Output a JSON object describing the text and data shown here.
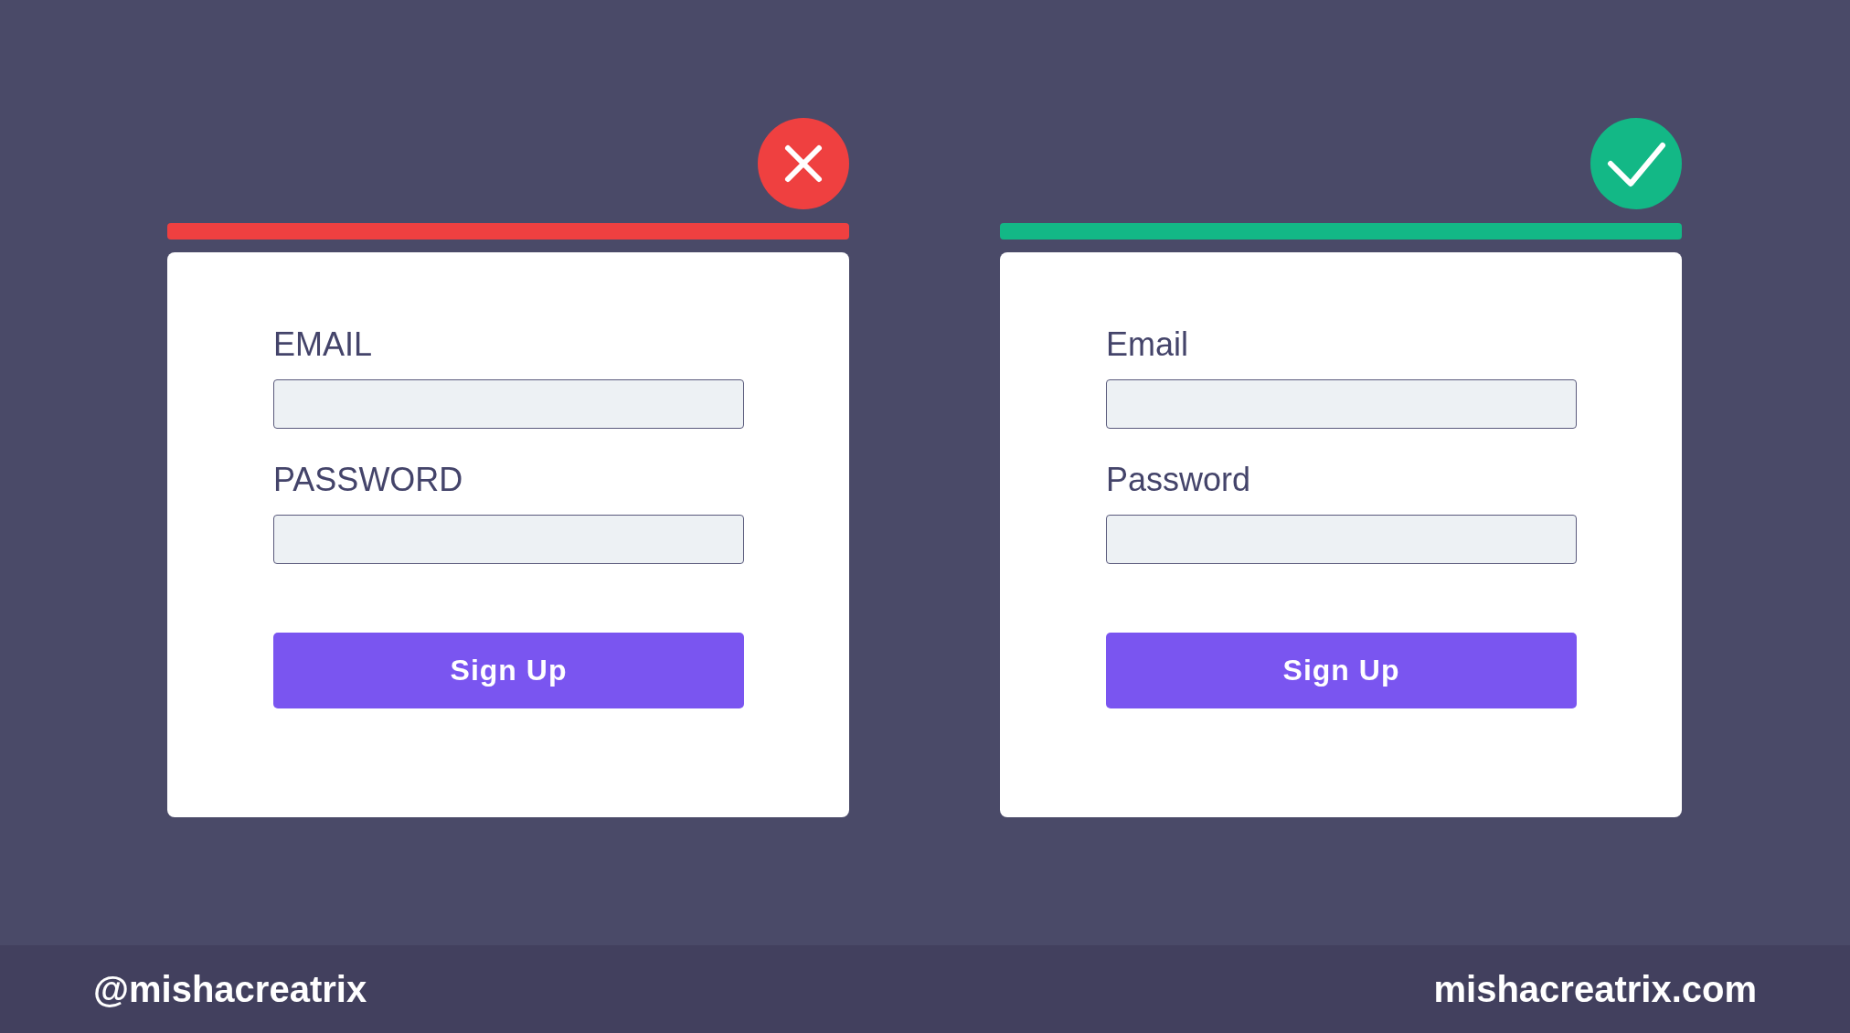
{
  "examples": [
    {
      "kind": "wrong",
      "color": "#ef4040",
      "fields": [
        {
          "label": "EMAIL"
        },
        {
          "label": "PASSWORD"
        }
      ],
      "button": "Sign Up"
    },
    {
      "kind": "right",
      "color": "#13b886",
      "fields": [
        {
          "label": "Email"
        },
        {
          "label": "Password"
        }
      ],
      "button": "Sign Up"
    }
  ],
  "footer": {
    "handle": "@mishacreatrix",
    "website": "mishacreatrix.com"
  }
}
